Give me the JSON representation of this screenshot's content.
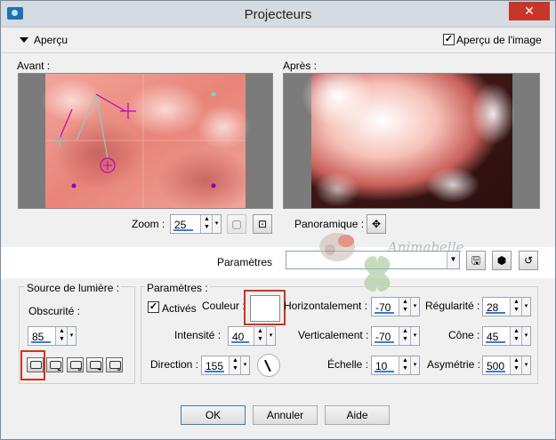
{
  "window": {
    "title": "Projecteurs",
    "close_glyph": "✕"
  },
  "preview_bar": {
    "section_label": "Aperçu",
    "toggle_label": "Aperçu de l'image",
    "toggle_checked": true
  },
  "before": {
    "label": "Avant :"
  },
  "after": {
    "label": "Après :"
  },
  "zoom": {
    "label": "Zoom :",
    "value": "25"
  },
  "pan": {
    "label": "Panoramique :"
  },
  "presets": {
    "label": "Paramètres",
    "value": ""
  },
  "light_source": {
    "group_label": "Source de lumière :",
    "darkness_label": "Obscurité :",
    "darkness_value": "85",
    "preset_numbers": [
      "",
      "2",
      "3",
      "4",
      "5"
    ]
  },
  "params": {
    "group_label": "Paramètres :",
    "active_label": "Activés",
    "active_checked": true,
    "color_label": "Couleur :",
    "color_value": "#ffffff",
    "intensity_label": "Intensité :",
    "intensity_value": "40",
    "direction_label": "Direction :",
    "direction_value": "155",
    "horizontal_label": "Horizontalement :",
    "horizontal_value": "-70",
    "vertical_label": "Verticalement :",
    "vertical_value": "-70",
    "scale_label": "Échelle :",
    "scale_value": "10",
    "regularity_label": "Régularité :",
    "regularity_value": "28",
    "cone_label": "Cône :",
    "cone_value": "45",
    "asymmetry_label": "Asymétrie :",
    "asymmetry_value": "500"
  },
  "buttons": {
    "ok": "OK",
    "cancel": "Annuler",
    "help": "Aide"
  },
  "watermark_text": "Animabelle"
}
